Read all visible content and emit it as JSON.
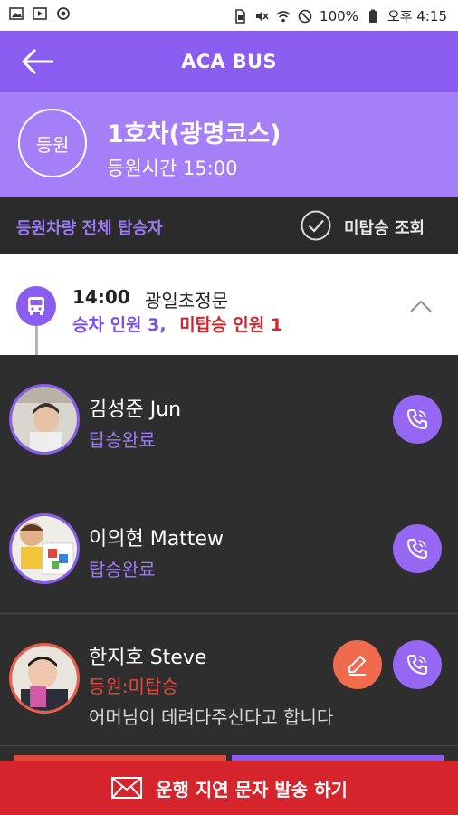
{
  "status_bar": {
    "battery": "100%",
    "time": "오후 4:15"
  },
  "app_bar": {
    "title": "ACA BUS"
  },
  "route": {
    "badge": "등원",
    "name": "1호차(광명코스)",
    "time": "등원시간 15:00"
  },
  "filter": {
    "label": "등원차량 전체 탑승자",
    "unboarded_query": "미탑승 조회"
  },
  "stop": {
    "time": "14:00",
    "place": "광일초정문",
    "boarded_text": "승차 인원 3,",
    "unboarded_text": "미탑승 인원 1"
  },
  "riders": [
    {
      "name": "김성준 Jun",
      "status": "탑승완료",
      "note": ""
    },
    {
      "name": "이의현 Mattew",
      "status": "탑승완료",
      "note": ""
    },
    {
      "name": "한지호 Steve",
      "status": "등원:미탑승",
      "note": "어머님이 데려다주신다고 합니다"
    }
  ],
  "bottom": {
    "delay_message_label": "운행 지연 문자 발송 하기"
  },
  "colors": {
    "primary": "#8a5cf0",
    "header_light": "#a47ff7",
    "alert": "#d6242c",
    "edit": "#f06a4d"
  },
  "icons": [
    "image-icon",
    "play-store-icon",
    "sync-icon",
    "sim-icon",
    "mute-icon",
    "wifi-icon",
    "no-disturb-icon",
    "battery-icon",
    "back-arrow-icon",
    "check-circle-icon",
    "bus-icon",
    "chevron-up-icon",
    "phone-icon",
    "pencil-icon",
    "mail-icon"
  ]
}
